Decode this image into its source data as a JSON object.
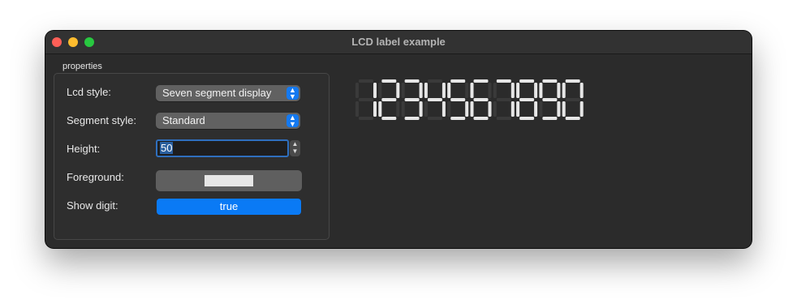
{
  "window": {
    "title": "LCD label example"
  },
  "properties": {
    "group_title": "properties",
    "lcd_style_label": "Lcd style:",
    "lcd_style_value": "Seven segment display",
    "segment_style_label": "Segment style:",
    "segment_style_value": "Standard",
    "height_label": "Height:",
    "height_value": "50",
    "foreground_label": "Foreground:",
    "foreground_color": "#e6e6e6",
    "show_digit_label": "Show digit:",
    "show_digit_value": "true"
  },
  "lcd": {
    "digits": "1234567890",
    "on_color": "#e6e6e6",
    "off_color": "#3a3a3a"
  }
}
